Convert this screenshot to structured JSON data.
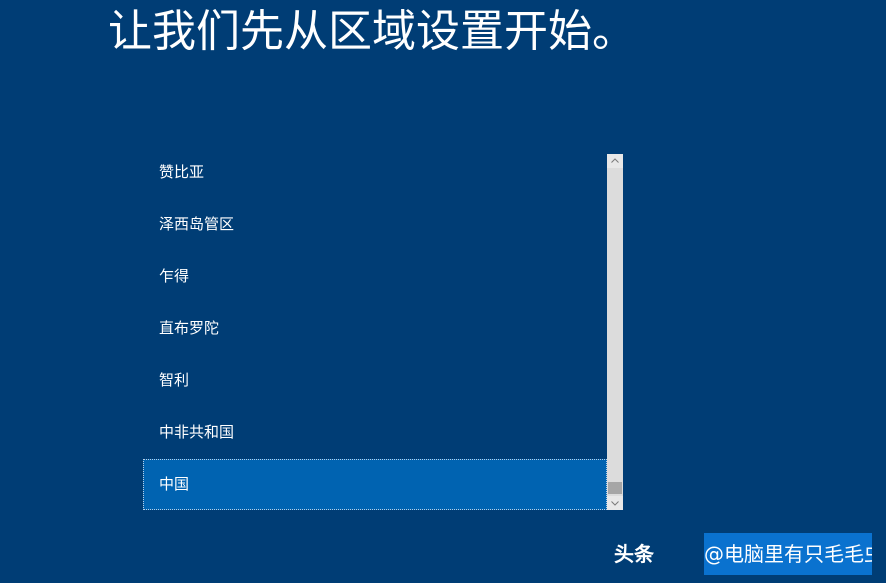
{
  "header": {
    "title": "让我们先从区域设置开始。"
  },
  "region_list": {
    "items": [
      {
        "label": "赞比亚",
        "selected": false
      },
      {
        "label": "泽西岛管区",
        "selected": false
      },
      {
        "label": "乍得",
        "selected": false
      },
      {
        "label": "直布罗陀",
        "selected": false
      },
      {
        "label": "智利",
        "selected": false
      },
      {
        "label": "中非共和国",
        "selected": false
      },
      {
        "label": "中国",
        "selected": true
      }
    ],
    "scrollbar": {
      "up_icon": "chevron-up-icon",
      "down_icon": "chevron-down-icon"
    }
  },
  "watermark": {
    "source": "头条",
    "handle": "@电脑里有只毛毛虫"
  },
  "colors": {
    "background": "#003d75",
    "selected_item": "#0063b1",
    "watermark_highlight": "#0a72cf"
  }
}
